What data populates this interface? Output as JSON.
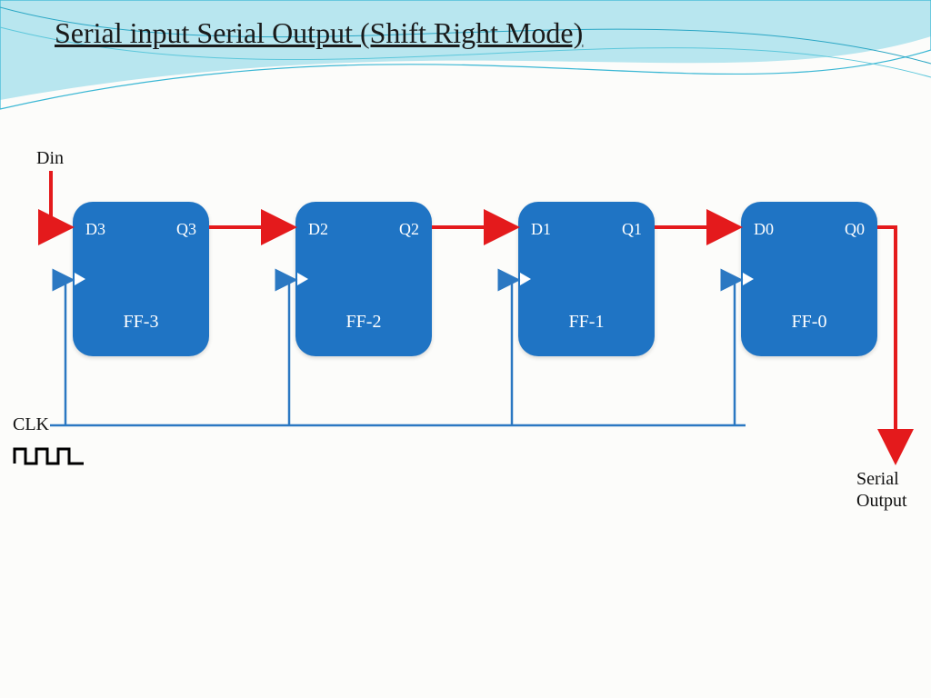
{
  "title": "Serial input Serial Output (Shift Right Mode)",
  "din_label": "Din",
  "clk_label": "CLK",
  "serial_output_label": "Serial\nOutput",
  "flipflops": [
    {
      "d": "D3",
      "q": "Q3",
      "name": "FF-3"
    },
    {
      "d": "D2",
      "q": "Q2",
      "name": "FF-2"
    },
    {
      "d": "D1",
      "q": "Q1",
      "name": "FF-1"
    },
    {
      "d": "D0",
      "q": "Q0",
      "name": "FF-0"
    }
  ],
  "colors": {
    "box": "#1f74c4",
    "arrow": "#e41a1c",
    "clk_line": "#2b78c2"
  }
}
